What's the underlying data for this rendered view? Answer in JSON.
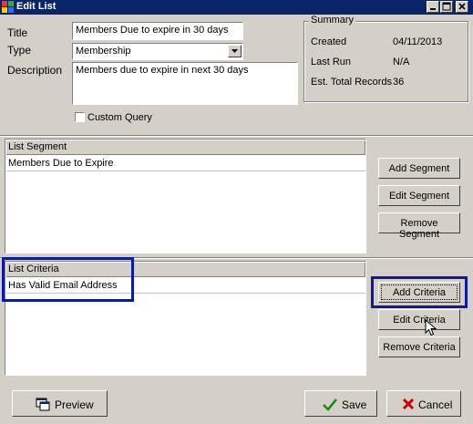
{
  "window": {
    "title": "Edit List",
    "icon": "app-icon"
  },
  "form": {
    "title_label": "Title",
    "title_value": "Members Due to expire in 30 days",
    "type_label": "Type",
    "type_value": "Membership",
    "description_label": "Description",
    "description_value": "Members due to expire in next 30 days",
    "custom_query_label": "Custom Query",
    "custom_query_checked": false
  },
  "summary": {
    "label": "Summary",
    "rows": [
      {
        "label": "Created",
        "value": "04/11/2013"
      },
      {
        "label": "Last Run",
        "value": "N/A"
      },
      {
        "label": "Est. Total Records",
        "value": "36"
      }
    ]
  },
  "segments": {
    "header": "List Segment",
    "rows": [
      "Members Due to Expire"
    ],
    "buttons": {
      "add": "Add Segment",
      "edit": "Edit Segment",
      "remove": "Remove Segment"
    }
  },
  "criteria": {
    "header": "List Criteria",
    "rows": [
      "Has Valid Email Address"
    ],
    "buttons": {
      "add": "Add Criteria",
      "edit": "Edit Criteria",
      "remove": "Remove Criteria"
    }
  },
  "footer": {
    "preview": "Preview",
    "save": "Save",
    "cancel": "Cancel"
  },
  "colors": {
    "titlebar": "#0a246a",
    "highlight": "#0b1aa0",
    "save_check": "#1a8a1a",
    "cancel_x": "#cc0000"
  }
}
